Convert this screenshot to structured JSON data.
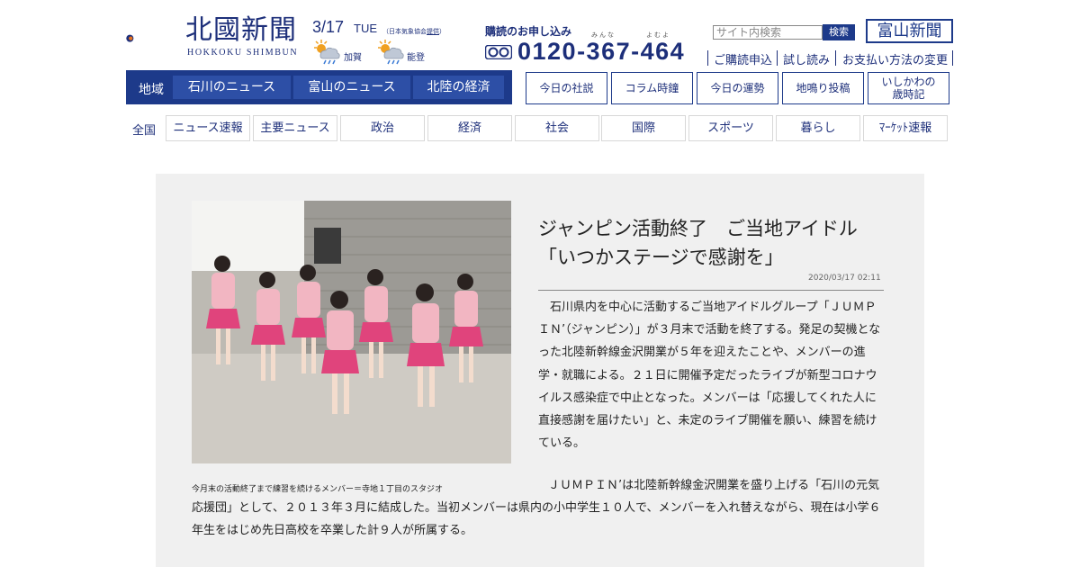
{
  "header": {
    "logo_title": "北國新聞",
    "logo_subtitle": "HOKKOKU SHIMBUN",
    "date": "3/17",
    "weekday": "TUE",
    "weather_credit_prefix": "（日本気象協会",
    "weather_credit_link": "提供",
    "weather_credit_suffix": "）",
    "weather": [
      {
        "area": "加賀",
        "icon": "sun-cloud-rain-icon"
      },
      {
        "area": "能登",
        "icon": "sun-cloud-rain-icon"
      }
    ],
    "subscribe_title": "購読のお申し込み",
    "phone_ruby": [
      "みんな",
      "よむよ"
    ],
    "phone": "0120-367-464",
    "search_placeholder": "サイト内検索",
    "search_button": "検索",
    "toyama_link": "富山新聞",
    "util_links": [
      "ご購読申込",
      "試し読み",
      "お支払い方法の変更"
    ]
  },
  "region_nav": {
    "label": "地域",
    "items": [
      "石川のニュース",
      "富山のニュース",
      "北陸の経済"
    ]
  },
  "top_boxes": [
    "今日の社説",
    "コラム時鐘",
    "今日の運勢",
    "地鳴り投稿",
    "いしかわの",
    "歳時記"
  ],
  "category_nav": {
    "label": "全国",
    "items": [
      "ニュース速報",
      "主要ニュース",
      "政治",
      "経済",
      "社会",
      "国際",
      "スポーツ",
      "暮らし",
      "ﾏｰｹｯﾄ速報"
    ]
  },
  "article": {
    "headline_line1": "ジャンピン活動終了　ご当地アイドル",
    "headline_line2": "「いつかステージで感謝を」",
    "timestamp": "2020/03/17 02:11",
    "caption": "今月末の活動終了まで練習を続けるメンバー＝寺地１丁目のスタジオ",
    "body1": "　石川県内を中心に活動するご当地アイドルグループ「ＪＵＭＰＩＮ’（ジャンピン）」が３月末で活動を終了する。発足の契機となった北陸新幹線金沢開業が５年を迎えたことや、メンバーの進学・就職による。２１日に開催予定だったライブが新型コロナウイルス感染症で中止となった。メンバーは「応援してくれた人に直接感謝を届けたい」と、未定のライブ開催を願い、練習を続けている。",
    "body2_line1": "　ＪＵＭＰＩＮ’は北陸新幹線金沢開業を盛り上げる「石川の",
    "body2_rest": "元気応援団」として、２０１３年３月に結成した。当初メンバーは県内の小中学生１０人で、メンバーを入れ替えながら、現在は小学６年生をはじめ先日高校を卒業した計９人が所属する。"
  },
  "colors": {
    "brand_navy": "#1d3a8a",
    "logo_orange": "#e8731e",
    "panel_bg": "#f0f0f0"
  }
}
